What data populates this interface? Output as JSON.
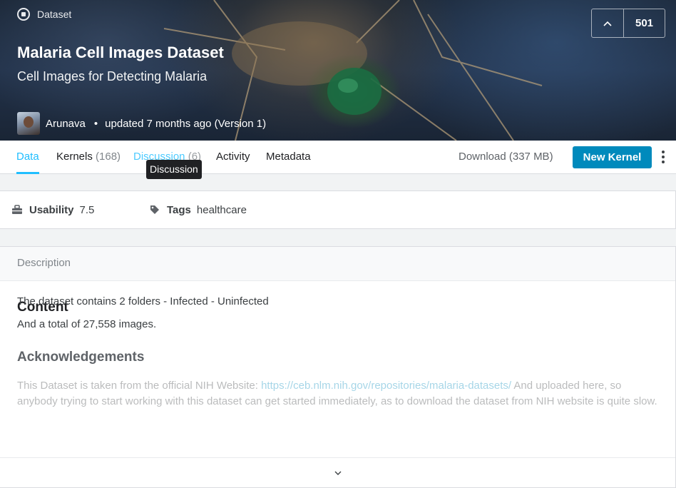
{
  "header": {
    "type_label": "Dataset",
    "title": "Malaria Cell Images Dataset",
    "subtitle": "Cell Images for Detecting Malaria",
    "owner": "Arunava",
    "separator": "•",
    "updated": "updated 7 months ago (Version 1)",
    "votes": "501",
    "upvote_icon": "chevron-up"
  },
  "tabs": [
    {
      "label": "Data",
      "count": ""
    },
    {
      "label": "Kernels",
      "count": "(168)"
    },
    {
      "label": "Discussion",
      "count": "(6)"
    },
    {
      "label": "Activity",
      "count": ""
    },
    {
      "label": "Metadata",
      "count": ""
    }
  ],
  "tooltip": "Discussion",
  "actions": {
    "download": "Download (337 MB)",
    "new_kernel": "New Kernel"
  },
  "meta": {
    "usability_label": "Usability",
    "usability_value": "7.5",
    "tags_label": "Tags",
    "tags_value": "healthcare"
  },
  "description": {
    "header": "Description",
    "content_heading": "Content",
    "line1": "The dataset contains 2 folders - Infected - Uninfected",
    "line2": "And a total of 27,558 images.",
    "ack_heading": "Acknowledgements",
    "ack_text_before": "This Dataset is taken from the official NIH Website: ",
    "ack_link": "https://ceb.nlm.nih.gov/repositories/malaria-datasets/",
    "ack_text_after": " And uploaded here, so anybody trying to start working with this dataset can get started immediately, as to download the dataset from NIH website is quite slow."
  },
  "colors": {
    "accent": "#20beff",
    "primary_button": "#008abc"
  }
}
